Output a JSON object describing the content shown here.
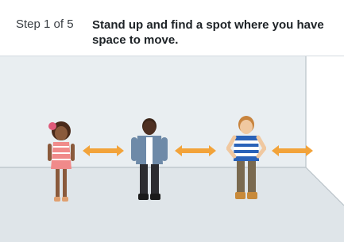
{
  "header": {
    "step_label": "Step 1 of 5",
    "instruction": "Stand up and find a spot where you have space to move."
  },
  "scene": {
    "wall_color": "#e9eef1",
    "floor_color": "#dfe5e9",
    "side_wall_color": "#ffffff",
    "arrow_color": "#f2a33a",
    "children": [
      {
        "name": "girl-child-figure",
        "icon": "girl-standing"
      },
      {
        "name": "boy-denim-figure",
        "icon": "boy-denim-jacket"
      },
      {
        "name": "boy-striped-figure",
        "icon": "boy-striped-shirt"
      }
    ],
    "arrows": [
      {
        "name": "spacing-arrow-1",
        "icon": "double-arrow"
      },
      {
        "name": "spacing-arrow-2",
        "icon": "double-arrow"
      },
      {
        "name": "spacing-arrow-3",
        "icon": "double-arrow"
      }
    ]
  }
}
